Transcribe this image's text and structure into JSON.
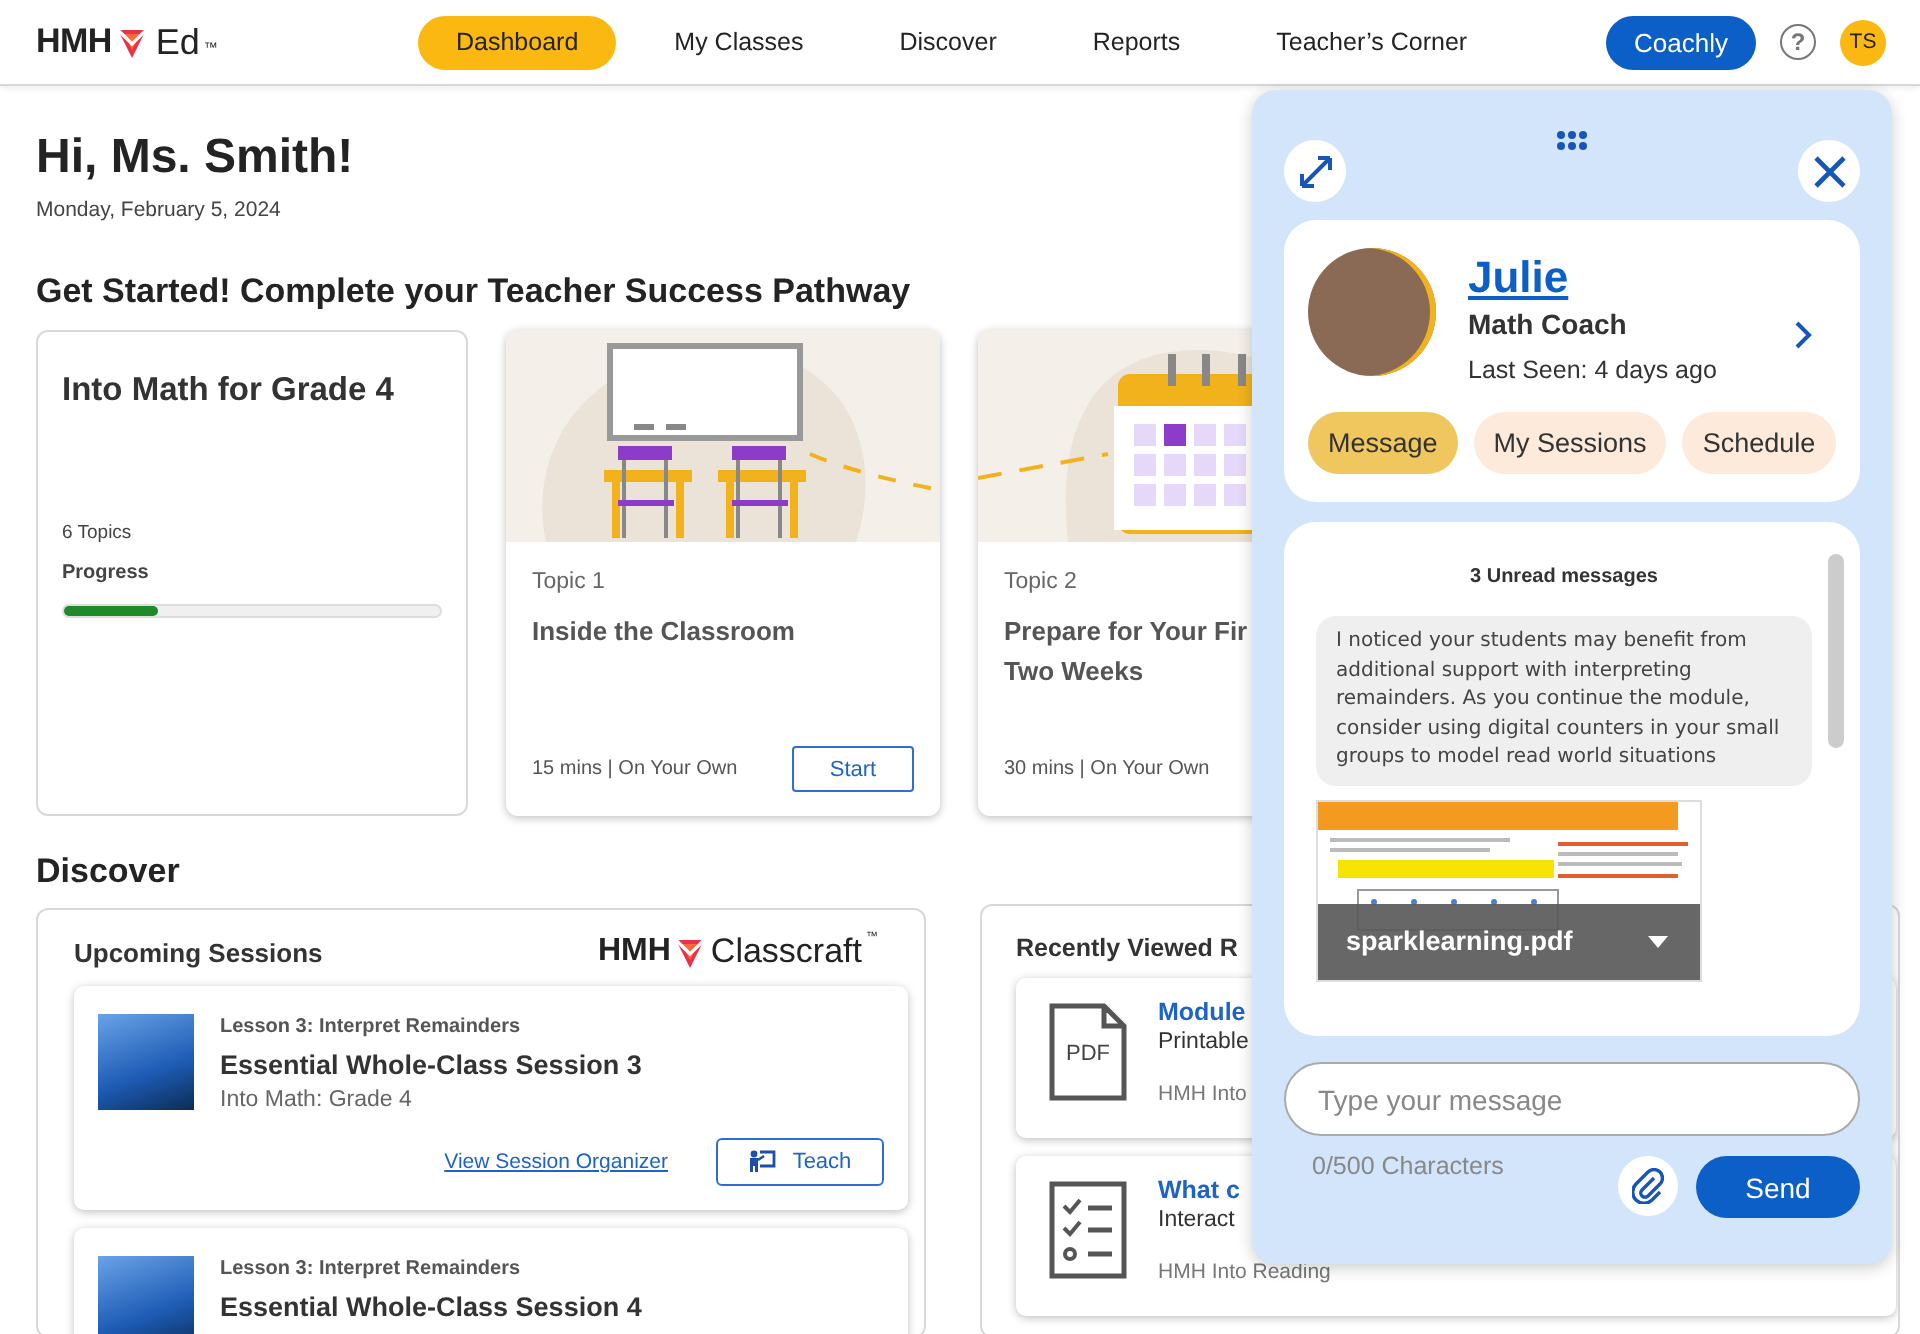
{
  "header": {
    "logo": {
      "brand": "HMH",
      "product": "Ed",
      "trademark": "™"
    },
    "nav": [
      {
        "label": "Dashboard",
        "selected": true
      },
      {
        "label": "My Classes",
        "selected": false
      },
      {
        "label": "Discover",
        "selected": false
      },
      {
        "label": "Reports",
        "selected": false
      },
      {
        "label": "Teacher’s Corner",
        "selected": false
      }
    ],
    "coach_button": "Coachly",
    "help": "?",
    "avatar": "TS"
  },
  "greeting": {
    "title": "Hi, Ms. Smith!",
    "date": "Monday, February 5, 2024"
  },
  "pathway": {
    "heading": "Get Started! Complete your Teacher Success Pathway",
    "course": {
      "title": "Into Math for Grade 4",
      "topics": "6 Topics",
      "progress_label": "Progress",
      "level": 0.25
    },
    "topics": [
      {
        "kind": "classroom",
        "label": "Topic 1",
        "title_lines": [
          "Inside the Classroom"
        ],
        "meta": "15 mins | On Your Own",
        "button": "Start"
      },
      {
        "kind": "calendar",
        "label": "Topic 2",
        "title_lines": [
          "Prepare for Your Fir",
          "Two Weeks"
        ],
        "meta": "30 mins | On Your Own"
      }
    ]
  },
  "discover": {
    "heading": "Discover",
    "upcoming": {
      "title": "Upcoming Sessions",
      "partner_logo": {
        "brand": "HMH",
        "product": "Classcraft",
        "trademark": "™"
      },
      "sessions": [
        {
          "lesson": "Lesson 3: Interpret Remainders",
          "title": "Essential Whole-Class Session 3",
          "course": "Into Math: Grade 4",
          "link": "View Session Organizer",
          "button": "Teach"
        },
        {
          "lesson": "Lesson 3: Interpret Remainders",
          "title": "Essential Whole-Class Session 4"
        }
      ]
    },
    "recent": {
      "title": "Recently Viewed R",
      "items": [
        {
          "kind": "pdf",
          "icon_text": "PDF",
          "title": "Module",
          "type": "Printable",
          "source": "HMH Into"
        },
        {
          "kind": "checklist",
          "title": "What c",
          "type": "Interact",
          "source": "HMH Into Reading"
        }
      ]
    }
  },
  "chat": {
    "coach": {
      "name": "Julie",
      "role": "Math Coach",
      "last_seen": "Last Seen: 4 days ago"
    },
    "tabs": [
      {
        "label": "Message",
        "selected": true
      },
      {
        "label": "My Sessions",
        "selected": false
      },
      {
        "label": "Schedule",
        "selected": false
      }
    ],
    "unread": "3 Unread messages",
    "messages": [
      {
        "kind": "text",
        "text": "I noticed your students may benefit from additional support with interpreting remainders. As you continue the module, consider using digital counters in your small groups to model read world situations"
      },
      {
        "kind": "file",
        "name": "sparklearning.pdf"
      }
    ],
    "input": {
      "placeholder": "Type your message"
    },
    "counter": "0/500 Characters",
    "send": "Send"
  }
}
